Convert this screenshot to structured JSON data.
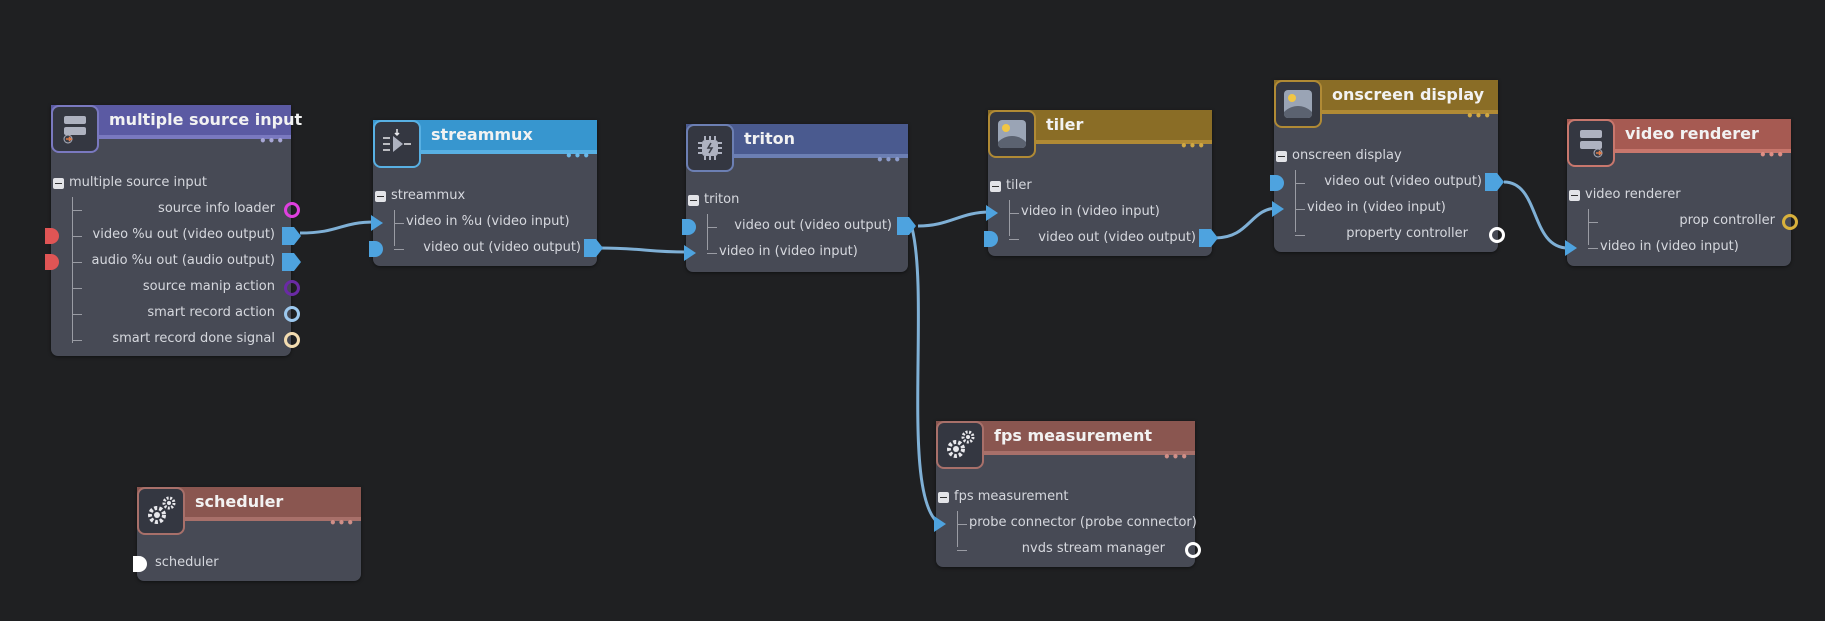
{
  "nodes": {
    "multiple_source_input": {
      "title": "multiple source input",
      "group": "multiple source input",
      "rows": [
        "source info loader",
        "video %u out (video output)",
        "audio %u out (audio output)",
        "source manip action",
        "smart record action",
        "smart record done signal"
      ],
      "color": "#5b5aa3",
      "line": "#7a79c0"
    },
    "streammux": {
      "title": "streammux",
      "group": "streammux",
      "rows": [
        "video in %u (video input)",
        "video out (video output)"
      ],
      "color": "#3796cf",
      "line": "#58b0e3"
    },
    "triton": {
      "title": "triton",
      "group": "triton",
      "rows": [
        "video out (video output)",
        "video in (video input)"
      ],
      "color": "#4a5a8f",
      "line": "#6c7fb3"
    },
    "tiler": {
      "title": "tiler",
      "group": "tiler",
      "rows": [
        "video in (video input)",
        "video out (video output)"
      ],
      "color": "#8a6d26",
      "line": "#b08a35"
    },
    "onscreen_display": {
      "title": "onscreen display",
      "group": "onscreen display",
      "rows": [
        "video out (video output)",
        "video in (video input)",
        "property controller"
      ],
      "color": "#8a6d26",
      "line": "#b08a35"
    },
    "video_renderer": {
      "title": "video renderer",
      "group": "video renderer",
      "rows": [
        "prop controller",
        "video in (video input)"
      ],
      "color": "#a65a52",
      "line": "#c8776d"
    },
    "fps_measurement": {
      "title": "fps measurement",
      "group": "fps measurement",
      "rows": [
        "probe connector (probe connector)",
        "nvds stream manager"
      ],
      "color": "#8a5650",
      "line": "#a8706a"
    },
    "scheduler": {
      "title": "scheduler",
      "group": "scheduler",
      "rows": [],
      "color": "#8a5650",
      "line": "#a8706a"
    }
  },
  "menu_dots": "•••",
  "colors": {
    "canvas": "#1f2022",
    "node_body": "#474a55",
    "wire": "#7fb0d6",
    "port_blue": "#4ea3df",
    "port_red": "#e05555",
    "port_magenta": "#e03fe0",
    "port_purple": "#6a2aa5",
    "port_lightblue": "#9cc8ee",
    "port_cream": "#f3dcb0",
    "port_yellow": "#d8b13c",
    "port_white": "#ffffff"
  },
  "icons": {
    "multiple_source_input": "server-rack-icon",
    "streammux": "mux-icon",
    "triton": "chip-icon",
    "tiler": "image-icon",
    "onscreen_display": "image-icon",
    "video_renderer": "server-rack-icon",
    "fps_measurement": "gears-icon",
    "scheduler": "gears-icon"
  }
}
